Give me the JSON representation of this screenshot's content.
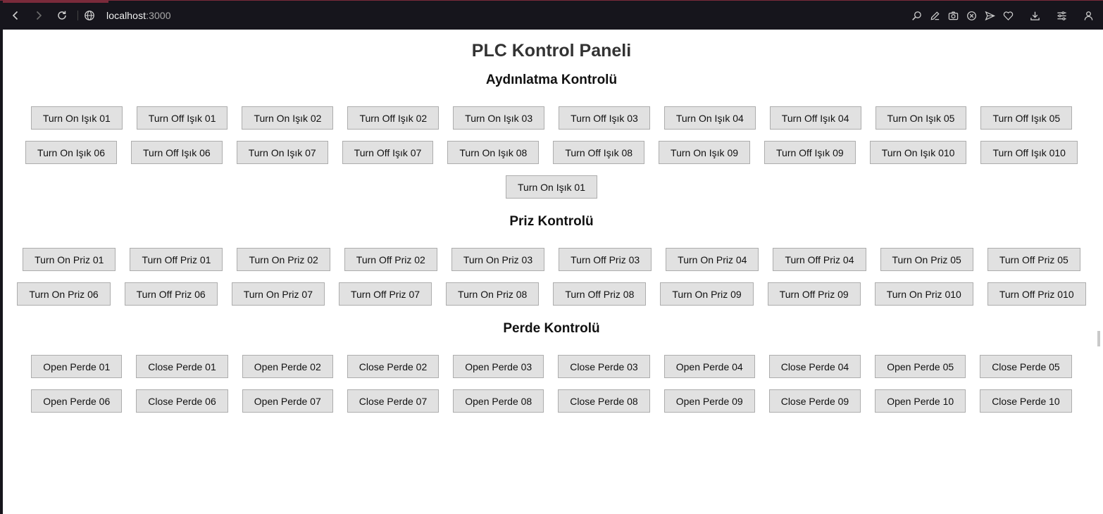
{
  "browser": {
    "url_host": "localhost",
    "url_port": ":3000"
  },
  "page": {
    "title": "PLC Kontrol Paneli"
  },
  "sections": {
    "lighting": {
      "title": "Aydınlatma Kontrolü",
      "row1": [
        "Turn On Işık 01",
        "Turn Off Işık 01",
        "Turn On Işık 02",
        "Turn Off Işık 02",
        "Turn On Işık 03",
        "Turn Off Işık 03",
        "Turn On Işık 04",
        "Turn Off Işık 04",
        "Turn On Işık 05",
        "Turn Off Işık 05"
      ],
      "row2": [
        "Turn On Işık 06",
        "Turn Off Işık 06",
        "Turn On Işık 07",
        "Turn Off Işık 07",
        "Turn On Işık 08",
        "Turn Off Işık 08",
        "Turn On Işık 09",
        "Turn Off Işık 09",
        "Turn On Işık 010",
        "Turn Off Işık 010"
      ],
      "row3": [
        "Turn On Işık 01"
      ]
    },
    "socket": {
      "title": "Priz Kontrolü",
      "row1": [
        "Turn On Priz 01",
        "Turn Off Priz 01",
        "Turn On Priz 02",
        "Turn Off Priz 02",
        "Turn On Priz 03",
        "Turn Off Priz 03",
        "Turn On Priz 04",
        "Turn Off Priz 04",
        "Turn On Priz 05",
        "Turn Off Priz 05"
      ],
      "row2": [
        "Turn On Priz 06",
        "Turn Off Priz 06",
        "Turn On Priz 07",
        "Turn Off Priz 07",
        "Turn On Priz 08",
        "Turn Off Priz 08",
        "Turn On Priz 09",
        "Turn Off Priz 09",
        "Turn On Priz 010",
        "Turn Off Priz 010"
      ]
    },
    "curtain": {
      "title": "Perde Kontrolü",
      "row1": [
        "Open Perde 01",
        "Close Perde 01",
        "Open Perde 02",
        "Close Perde 02",
        "Open Perde 03",
        "Close Perde 03",
        "Open Perde 04",
        "Close Perde 04",
        "Open Perde 05",
        "Close Perde 05"
      ],
      "row2": [
        "Open Perde 06",
        "Close Perde 06",
        "Open Perde 07",
        "Close Perde 07",
        "Open Perde 08",
        "Close Perde 08",
        "Open Perde 09",
        "Close Perde 09",
        "Open Perde 10",
        "Close Perde 10"
      ]
    }
  }
}
